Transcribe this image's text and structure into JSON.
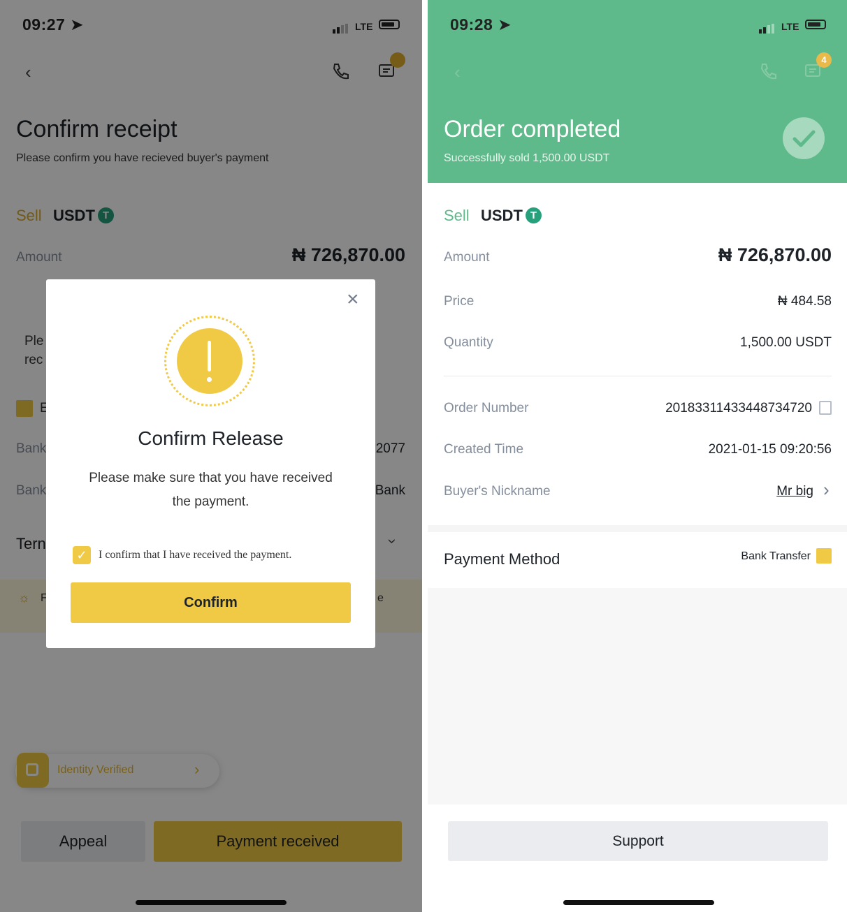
{
  "left": {
    "status": {
      "time": "09:27 ➤",
      "network": "LTE"
    },
    "title": "Confirm receipt",
    "subtitle": "Please confirm you have recieved buyer's payment",
    "side": "Sell",
    "asset": "USDT",
    "amount_label": "Amount",
    "amount_value": "₦ 726,870.00",
    "partial": {
      "ple": "Ple",
      "rec": "rec",
      "b": "E",
      "bank1": "Bank",
      "bank2": "Bank",
      "term": "Tern",
      "num_suffix": "2077",
      "bank_suffix": "Bank",
      "f": "F",
      "e": "e"
    },
    "identity": "Identity Verified",
    "appeal": "Appeal",
    "payment_received": "Payment received",
    "modal": {
      "title": "Confirm Release",
      "message_line1": "Please make sure that you have received",
      "message_line2": "the payment.",
      "checkbox_label": "I confirm that I have received the payment.",
      "confirm": "Confirm"
    }
  },
  "right": {
    "status": {
      "time": "09:28 ➤",
      "network": "LTE",
      "badge": "4"
    },
    "title": "Order completed",
    "subtitle": "Successfully sold 1,500.00 USDT",
    "side": "Sell",
    "asset": "USDT",
    "rows": [
      {
        "label": "Amount",
        "value": "₦ 726,870.00"
      },
      {
        "label": "Price",
        "value": "₦ 484.58"
      },
      {
        "label": "Quantity",
        "value": "1,500.00 USDT"
      },
      {
        "label": "Order Number",
        "value": "20183311433448734720"
      },
      {
        "label": "Created Time",
        "value": "2021-01-15 09:20:56"
      },
      {
        "label": "Buyer's Nickname",
        "value": "Mr big"
      }
    ],
    "payment_method_label": "Payment Method",
    "payment_method_value": "Bank Transfer",
    "support": "Support"
  },
  "colors": {
    "accent_yellow": "#f0c945",
    "success_green": "#5eba8a",
    "tether_green": "#26a17b"
  }
}
